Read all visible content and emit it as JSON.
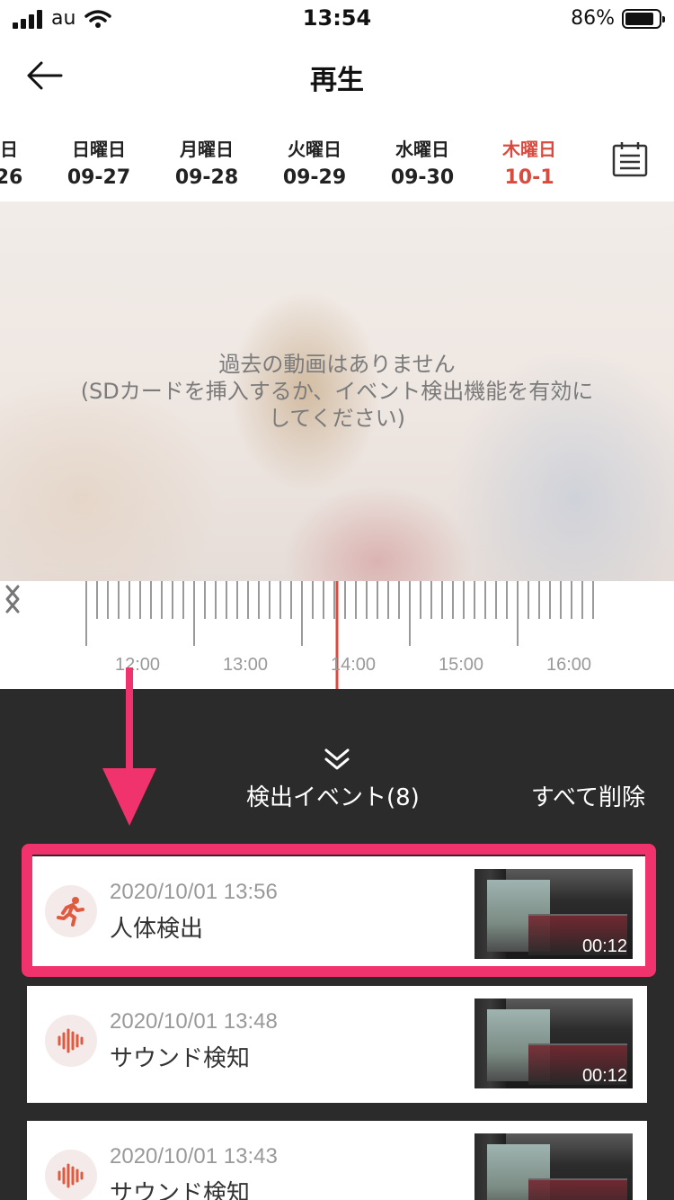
{
  "status_bar": {
    "carrier": "au",
    "time": "13:54",
    "battery": "86%",
    "battery_level": 0.86
  },
  "header": {
    "title": "再生",
    "back_icon": "arrow-left-icon"
  },
  "date_strip": {
    "items": [
      {
        "dow": "日",
        "md": "26",
        "active": false
      },
      {
        "dow": "日曜日",
        "md": "09-27",
        "active": false
      },
      {
        "dow": "月曜日",
        "md": "09-28",
        "active": false
      },
      {
        "dow": "火曜日",
        "md": "09-29",
        "active": false
      },
      {
        "dow": "水曜日",
        "md": "09-30",
        "active": false
      },
      {
        "dow": "木曜日",
        "md": "10-1",
        "active": true
      }
    ],
    "calendar_icon": "calendar-icon",
    "active_color": "#d94b3f"
  },
  "video": {
    "message_line1": "過去の動画はありません",
    "message_line2": "(SDカードを挿入するか、イベント検出機能を有効に",
    "message_line3": "してください)"
  },
  "timeline": {
    "labels": [
      "12:00",
      "13:00",
      "14:00",
      "15:00",
      "16:00"
    ],
    "current_time": "13:54",
    "cursor_color": "#d94b3f"
  },
  "events": {
    "title": "検出イベント(8)",
    "delete_all": "すべて削除",
    "items": [
      {
        "time": "2020/10/01 13:56",
        "label": "人体検出",
        "icon": "running-person-icon",
        "duration": "00:12",
        "highlighted": true
      },
      {
        "time": "2020/10/01 13:48",
        "label": "サウンド検知",
        "icon": "sound-wave-icon",
        "duration": "00:12",
        "highlighted": false
      },
      {
        "time": "2020/10/01 13:43",
        "label": "サウンド検知",
        "icon": "sound-wave-icon",
        "duration": "",
        "highlighted": false
      }
    ]
  },
  "annotation": {
    "highlight_color": "#f0326d",
    "arrow_color": "#f0326d"
  }
}
